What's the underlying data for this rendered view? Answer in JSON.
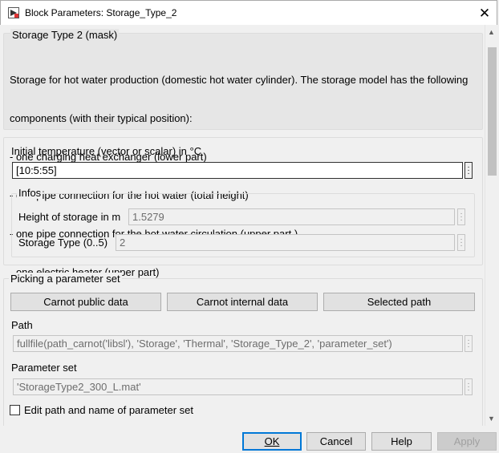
{
  "window": {
    "title": "Block Parameters: Storage_Type_2",
    "close_glyph": "✕"
  },
  "mask": {
    "legend": "Storage Type 2 (mask)",
    "description_lines": [
      "Storage for hot water production (domestic hot water cylinder). The storage model has the following",
      "components (with their typical position):",
      "- one charging heat exchanger (lower part)",
      "- one pipe connection for the hot water (total height)",
      "- one pipe connection for the hot water circulation (upper part )",
      "- one electric heater (upper part)"
    ]
  },
  "params": {
    "initial_temp_label": "Initial temperature (vector or scalar) in °C",
    "initial_temp_value": "[10:5:55]",
    "infos": {
      "legend": "Infos",
      "height_label": "Height of storage in m",
      "height_value": "1.5279",
      "type_label": "Storage Type (0..5)",
      "type_value": "2"
    }
  },
  "picking": {
    "legend": "Picking a parameter set",
    "buttons": [
      "Carnot public data",
      "Carnot internal data",
      "Selected path"
    ],
    "path_label": "Path",
    "path_value": "fullfile(path_carnot('libsl'), 'Storage', 'Thermal', 'Storage_Type_2', 'parameter_set')",
    "set_label": "Parameter set",
    "set_value": "'StorageType2_300_L.mat'",
    "edit_checkbox_label": "Edit path and name of parameter set",
    "edit_checkbox_checked": false
  },
  "footer": {
    "ok_label": "OK",
    "cancel_label": "Cancel",
    "help_label": "Help",
    "apply_label": "Apply"
  },
  "colors": {
    "accent": "#0078d7",
    "window_bg": "#f0f0f0"
  },
  "icons": {
    "app": "simulink-block-icon",
    "close": "close-icon",
    "more": "more-dots-icon",
    "scroll_up": "scroll-up-icon",
    "scroll_down": "scroll-down-icon"
  }
}
